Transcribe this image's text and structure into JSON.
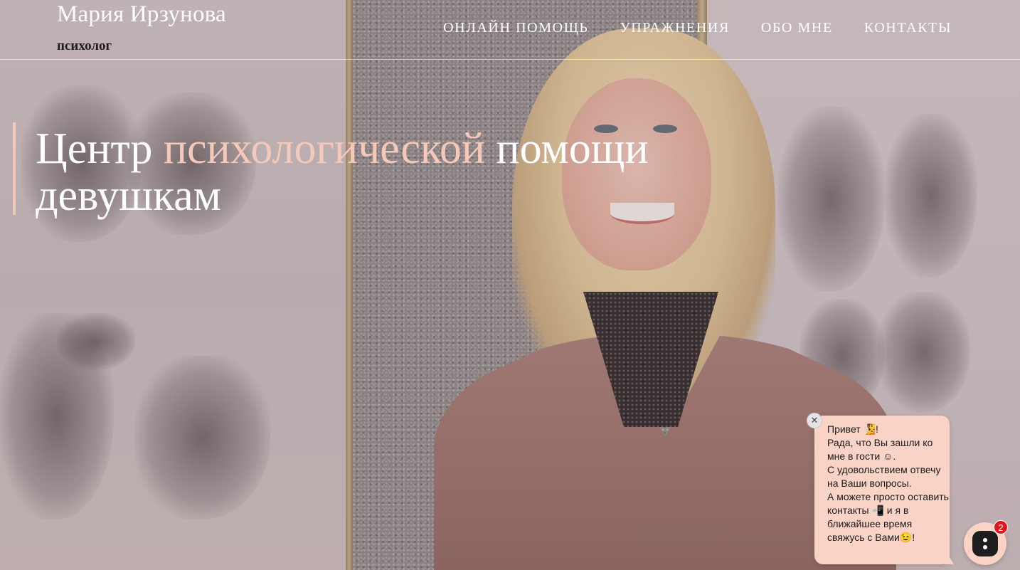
{
  "header": {
    "brand_name": "Мария Ирзунова",
    "brand_subtitle": "психолог",
    "nav": [
      {
        "label": "Онлайн помощь"
      },
      {
        "label": "Упражнения"
      },
      {
        "label": "Обо мне"
      },
      {
        "label": "Контакты"
      }
    ]
  },
  "hero": {
    "title_part1": "Центр ",
    "title_accent": "психологической",
    "title_part2": " помощи девушкам"
  },
  "chat": {
    "message": "Привет 🧏!\nРада, что Вы зашли ко мне в гости ☺.\nС удовольствием отвечу на Ваши вопросы.\nА можете просто оставить контакты 📲 и я в ближайшее время свяжусь с Вами😉!",
    "close_icon": "close-icon",
    "unread_count": "2"
  },
  "colors": {
    "accent": "#f4c9b9",
    "chat_bg": "#f8d3c6",
    "badge": "#e0141e"
  }
}
